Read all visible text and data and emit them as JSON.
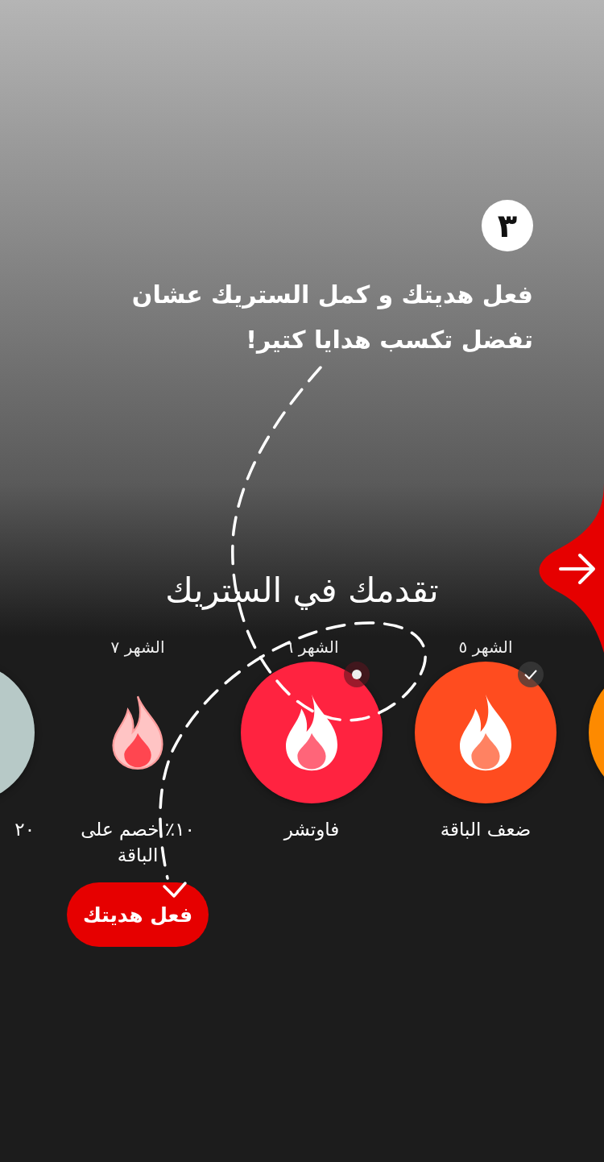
{
  "step": {
    "number": "٣",
    "text": "فعل هديتك و كمل الستريك عشان تفضل تكسب هدايا كتير!"
  },
  "streak": {
    "title": "تقدمك في الستريك",
    "months": [
      {
        "kind": "partial",
        "color": "#fd8a00"
      },
      {
        "kind": "done",
        "label": "الشهر ٥",
        "reward": "ضعف الباقة",
        "color": "#ff4c1f"
      },
      {
        "kind": "current",
        "label": "الشهر ٦",
        "reward": "فاوتشر",
        "color": "#ff2340"
      },
      {
        "kind": "gift",
        "label": "الشهر ٧",
        "reward": "١٠٪ خصم على الباقة",
        "action": "فعل هديتك"
      },
      {
        "kind": "partial",
        "reward": "٢٠",
        "color": "#b7c9c7"
      }
    ]
  }
}
